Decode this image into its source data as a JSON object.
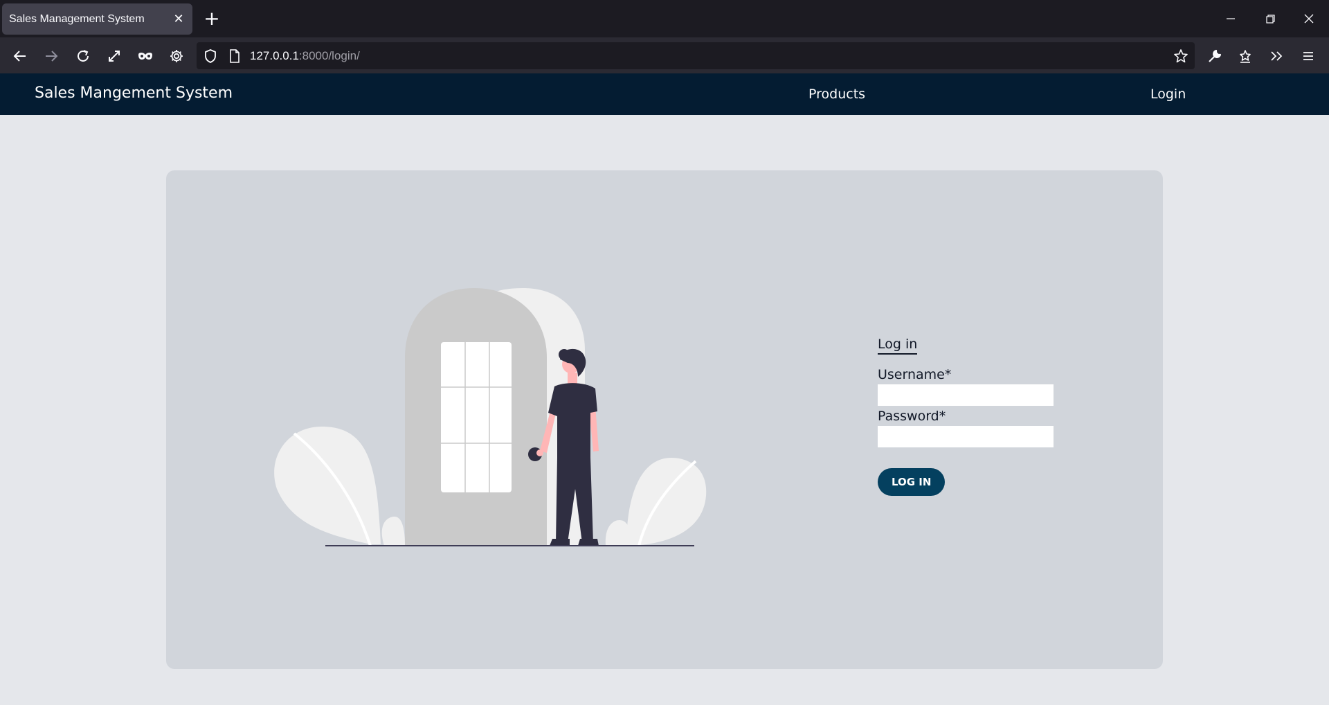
{
  "browser": {
    "tab_title": "Sales Management System",
    "tab_close": "✕",
    "new_tab": "+",
    "url_host": "127.0.0.1",
    "url_rest": ":8000/login/",
    "icons": [
      "back-icon",
      "forward-icon",
      "reload-icon",
      "fullscreen-icon",
      "mask-icon",
      "gear-icon",
      "shield-icon",
      "page-icon",
      "star-icon",
      "wrench-icon",
      "extensions-icon",
      "overflow-icon",
      "menu-icon",
      "minimize-icon",
      "restore-icon",
      "close-window-icon"
    ]
  },
  "site": {
    "brand": "Sales Mangement System",
    "nav": {
      "products": "Products",
      "login": "Login"
    },
    "colors": {
      "nav_bg": "#041c32",
      "page_bg": "#e5e7eb",
      "card_bg": "#d1d5db",
      "button_bg": "#04405f"
    }
  },
  "login_form": {
    "title": "Log in",
    "username_label": "Username*",
    "username_value": "",
    "password_label": "Password*",
    "password_value": "",
    "submit_label": "LOG IN"
  }
}
